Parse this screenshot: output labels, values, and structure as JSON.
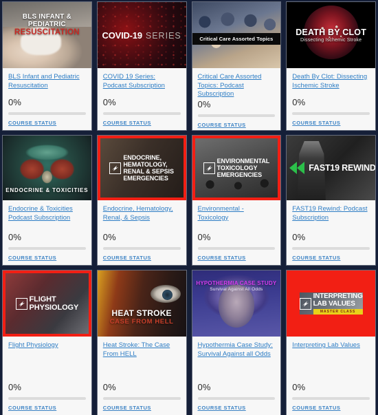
{
  "page": {
    "background_color": "#151f38",
    "card_background": "#f7f7f7",
    "link_color": "#2c7cc4",
    "status_color": "#3b82c4",
    "progress_track_color": "#dcdcdc",
    "accent_red": "#f21f14"
  },
  "courses": [
    {
      "id": "bls-infant-pediatric-resuscitation",
      "title": "BLS Infant and Pediatric Resuscitation",
      "progress_label": "0%",
      "progress_value": 0,
      "status_label": "COURSE STATUS",
      "thumbnail": {
        "style": "bls",
        "line1": "BLS INFANT & PEDIATRIC",
        "line2": "RESUSCITATION"
      }
    },
    {
      "id": "covid-19-series-podcast-subscription",
      "title": "COVID 19 Series: Podcast Subscription",
      "progress_label": "0%",
      "progress_value": 0,
      "status_label": "COURSE STATUS",
      "thumbnail": {
        "style": "covid",
        "line1": "COVID-19",
        "line2": "SERIES"
      }
    },
    {
      "id": "critical-care-assorted-topics-podcast-subscription",
      "title": "Critical Care Assorted Topics: Podcast Subscription",
      "progress_label": "0%",
      "progress_value": 0,
      "status_label": "COURSE STATUS",
      "thumbnail": {
        "style": "critical-care",
        "line1": "Critical Care Assorted Topics"
      }
    },
    {
      "id": "death-by-clot-dissecting-ischemic-stroke",
      "title": "Death By Clot: Dissecting Ischemic Stroke",
      "progress_label": "0%",
      "progress_value": 0,
      "status_label": "COURSE STATUS",
      "thumbnail": {
        "style": "death-by-clot",
        "line1": "DEATH BY CLOT",
        "line2": "Dissecting Ischemic Stroke"
      }
    },
    {
      "id": "endocrine-toxicities-podcast-subscription",
      "title": "Endocrine & Toxicities Podcast Subscription",
      "progress_label": "0%",
      "progress_value": 0,
      "status_label": "COURSE STATUS",
      "thumbnail": {
        "style": "endocrine-toxicities",
        "line1": "ENDOCRINE & TOXICITIES"
      }
    },
    {
      "id": "endocrine-hematology-renal-sepsis",
      "title": "Endocrine, Hematology, Renal, & Sepsis",
      "progress_label": "0%",
      "progress_value": 0,
      "status_label": "COURSE STATUS",
      "thumbnail": {
        "style": "fast-red-frame",
        "line1": "ENDOCRINE,",
        "line2": "HEMATOLOGY,",
        "line3": "RENAL & SEPSIS",
        "line4": "EMERGENCIES"
      }
    },
    {
      "id": "environmental-toxicology",
      "title": "Environmental - Toxicology",
      "progress_label": "0%",
      "progress_value": 0,
      "status_label": "COURSE STATUS",
      "thumbnail": {
        "style": "fast-red-frame",
        "line1": "ENVIRONMENTAL",
        "line2": "TOXICOLOGY",
        "line3": "EMERGENCIES"
      }
    },
    {
      "id": "fast19-rewind-podcast-subscription",
      "title": "FAST19 Rewind: Podcast Subscription",
      "progress_label": "0%",
      "progress_value": 0,
      "status_label": "COURSE STATUS",
      "thumbnail": {
        "style": "fast19-rewind",
        "line1": "FAST19 REWIND"
      }
    },
    {
      "id": "flight-physiology",
      "title": "Flight Physiology",
      "progress_label": "0%",
      "progress_value": 0,
      "status_label": "COURSE STATUS",
      "thumbnail": {
        "style": "fast-red-frame",
        "line1": "FLIGHT",
        "line2": "PHYSIOLOGY"
      }
    },
    {
      "id": "heat-stroke-the-case-from-hell",
      "title": "Heat Stroke: The Case From HELL",
      "progress_label": "0%",
      "progress_value": 0,
      "status_label": "COURSE STATUS",
      "thumbnail": {
        "style": "heat-stroke",
        "line1": "HEAT STROKE",
        "line2": "CASE FROM HELL"
      }
    },
    {
      "id": "hypothermia-case-study-survival-against-all-odds",
      "title": "Hypothermia Case Study: Survival Against all Odds",
      "progress_label": "0%",
      "progress_value": 0,
      "status_label": "COURSE STATUS",
      "thumbnail": {
        "style": "hypothermia",
        "line1": "HYPOTHERMIA CASE STUDY",
        "line2": "Survival Against All Odds"
      }
    },
    {
      "id": "interpreting-lab-values",
      "title": "Interpreting Lab Values",
      "progress_label": "0%",
      "progress_value": 0,
      "status_label": "COURSE STATUS",
      "thumbnail": {
        "style": "interpreting-lab-values",
        "line1": "INTERPRETING",
        "line2": "LAB VALUES",
        "line3": "MASTER CLASS"
      }
    }
  ]
}
